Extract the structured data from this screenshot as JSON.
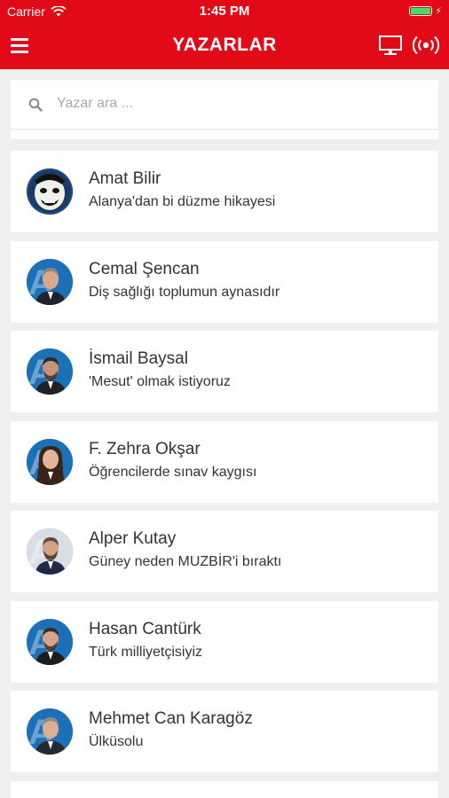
{
  "status_bar": {
    "carrier": "Carrier",
    "time": "1:45 PM",
    "battery_level": 1.0
  },
  "header": {
    "title": "YAZARLAR",
    "menu_icon": "hamburger-menu-icon",
    "tv_icon": "tv-monitor-icon",
    "live_icon": "live-broadcast-icon"
  },
  "search": {
    "placeholder": "Yazar ara ...",
    "value": ""
  },
  "authors": [
    {
      "name": "Amat Bilir",
      "title": "Alanya'dan bi düzme hikayesi"
    },
    {
      "name": "Cemal Şencan",
      "title": "Diş sağlığı toplumun aynasıdır"
    },
    {
      "name": "İsmail Baysal",
      "title": "'Mesut' olmak istiyoruz"
    },
    {
      "name": "F. Zehra Okşar",
      "title": "Öğrencilerde sınav kaygısı"
    },
    {
      "name": "Alper Kutay",
      "title": "Güney neden MUZBİR'i bıraktı"
    },
    {
      "name": "Hasan Cantürk",
      "title": "Türk milliyetçisiyiz"
    },
    {
      "name": "Mehmet Can Karagöz",
      "title": "Ülküsolu"
    }
  ],
  "colors": {
    "brand_red": "#e30a17",
    "background": "#efefef",
    "card": "#ffffff",
    "text": "#333333",
    "battery_green": "#4cd964"
  }
}
